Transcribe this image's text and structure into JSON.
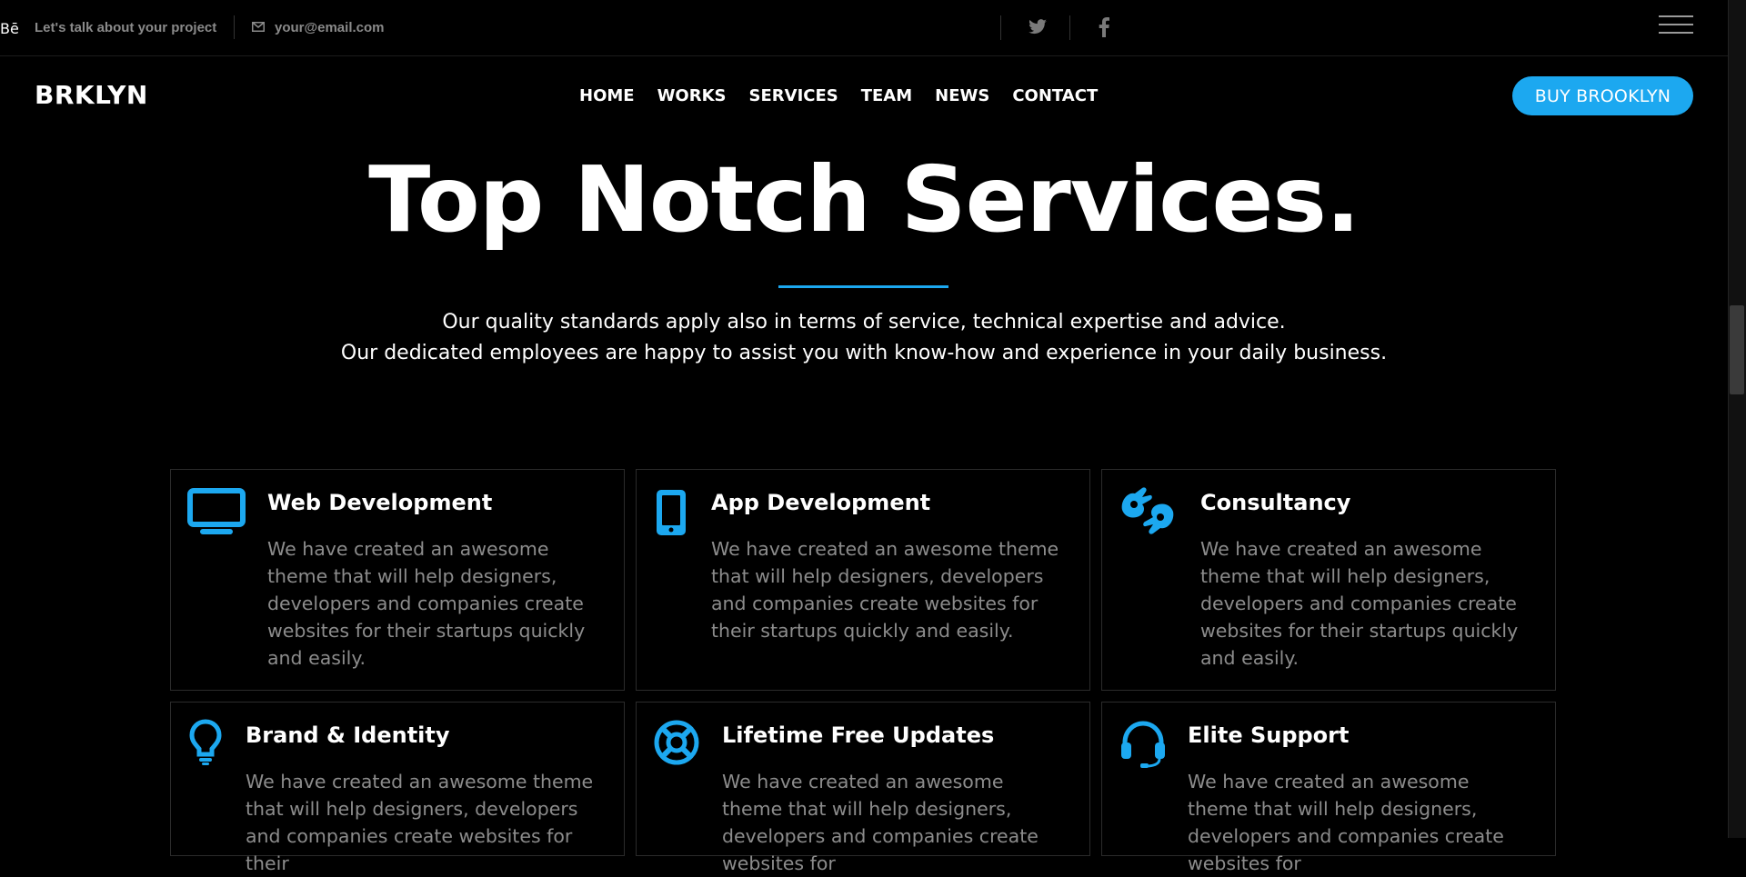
{
  "topbar": {
    "tagline": "Let's talk about your project",
    "email": "your@email.com",
    "social": {
      "behance": "Bē"
    }
  },
  "nav": {
    "logo": "BRKLYN",
    "items": [
      "HOME",
      "WORKS",
      "SERVICES",
      "TEAM",
      "NEWS",
      "CONTACT"
    ],
    "buy_label": "BUY BROOKLYN"
  },
  "hero": {
    "title": "Top Notch Services.",
    "subtitle_line1": "Our quality standards apply also in terms of service, technical expertise and advice.",
    "subtitle_line2": "Our dedicated employees are happy to assist you with know-how and experience in your daily business."
  },
  "services": [
    {
      "icon": "monitor-icon",
      "title": "Web Development",
      "desc": "We have created an awesome theme that will help designers, developers and companies create websites for their startups quickly and easily."
    },
    {
      "icon": "mobile-icon",
      "title": "App Development",
      "desc": "We have created an awesome theme that will help designers, developers and companies create websites for their startups quickly and easily."
    },
    {
      "icon": "sign-language-icon",
      "title": "Consultancy",
      "desc": "We have created an awesome theme that will help designers, developers and companies create websites for their startups quickly and easily."
    },
    {
      "icon": "lightbulb-icon",
      "title": "Brand & Identity",
      "desc": "We have created an awesome theme that will help designers, developers and companies create websites for their"
    },
    {
      "icon": "life-ring-icon",
      "title": "Lifetime Free Updates",
      "desc": "We have created an awesome theme that will help designers, developers and companies create websites for"
    },
    {
      "icon": "headset-icon",
      "title": "Elite Support",
      "desc": "We have created an awesome theme that will help designers, developers and companies create websites for"
    }
  ],
  "colors": {
    "accent": "#1ca8f0",
    "background": "#000000",
    "muted_text": "#8c8c8c"
  }
}
